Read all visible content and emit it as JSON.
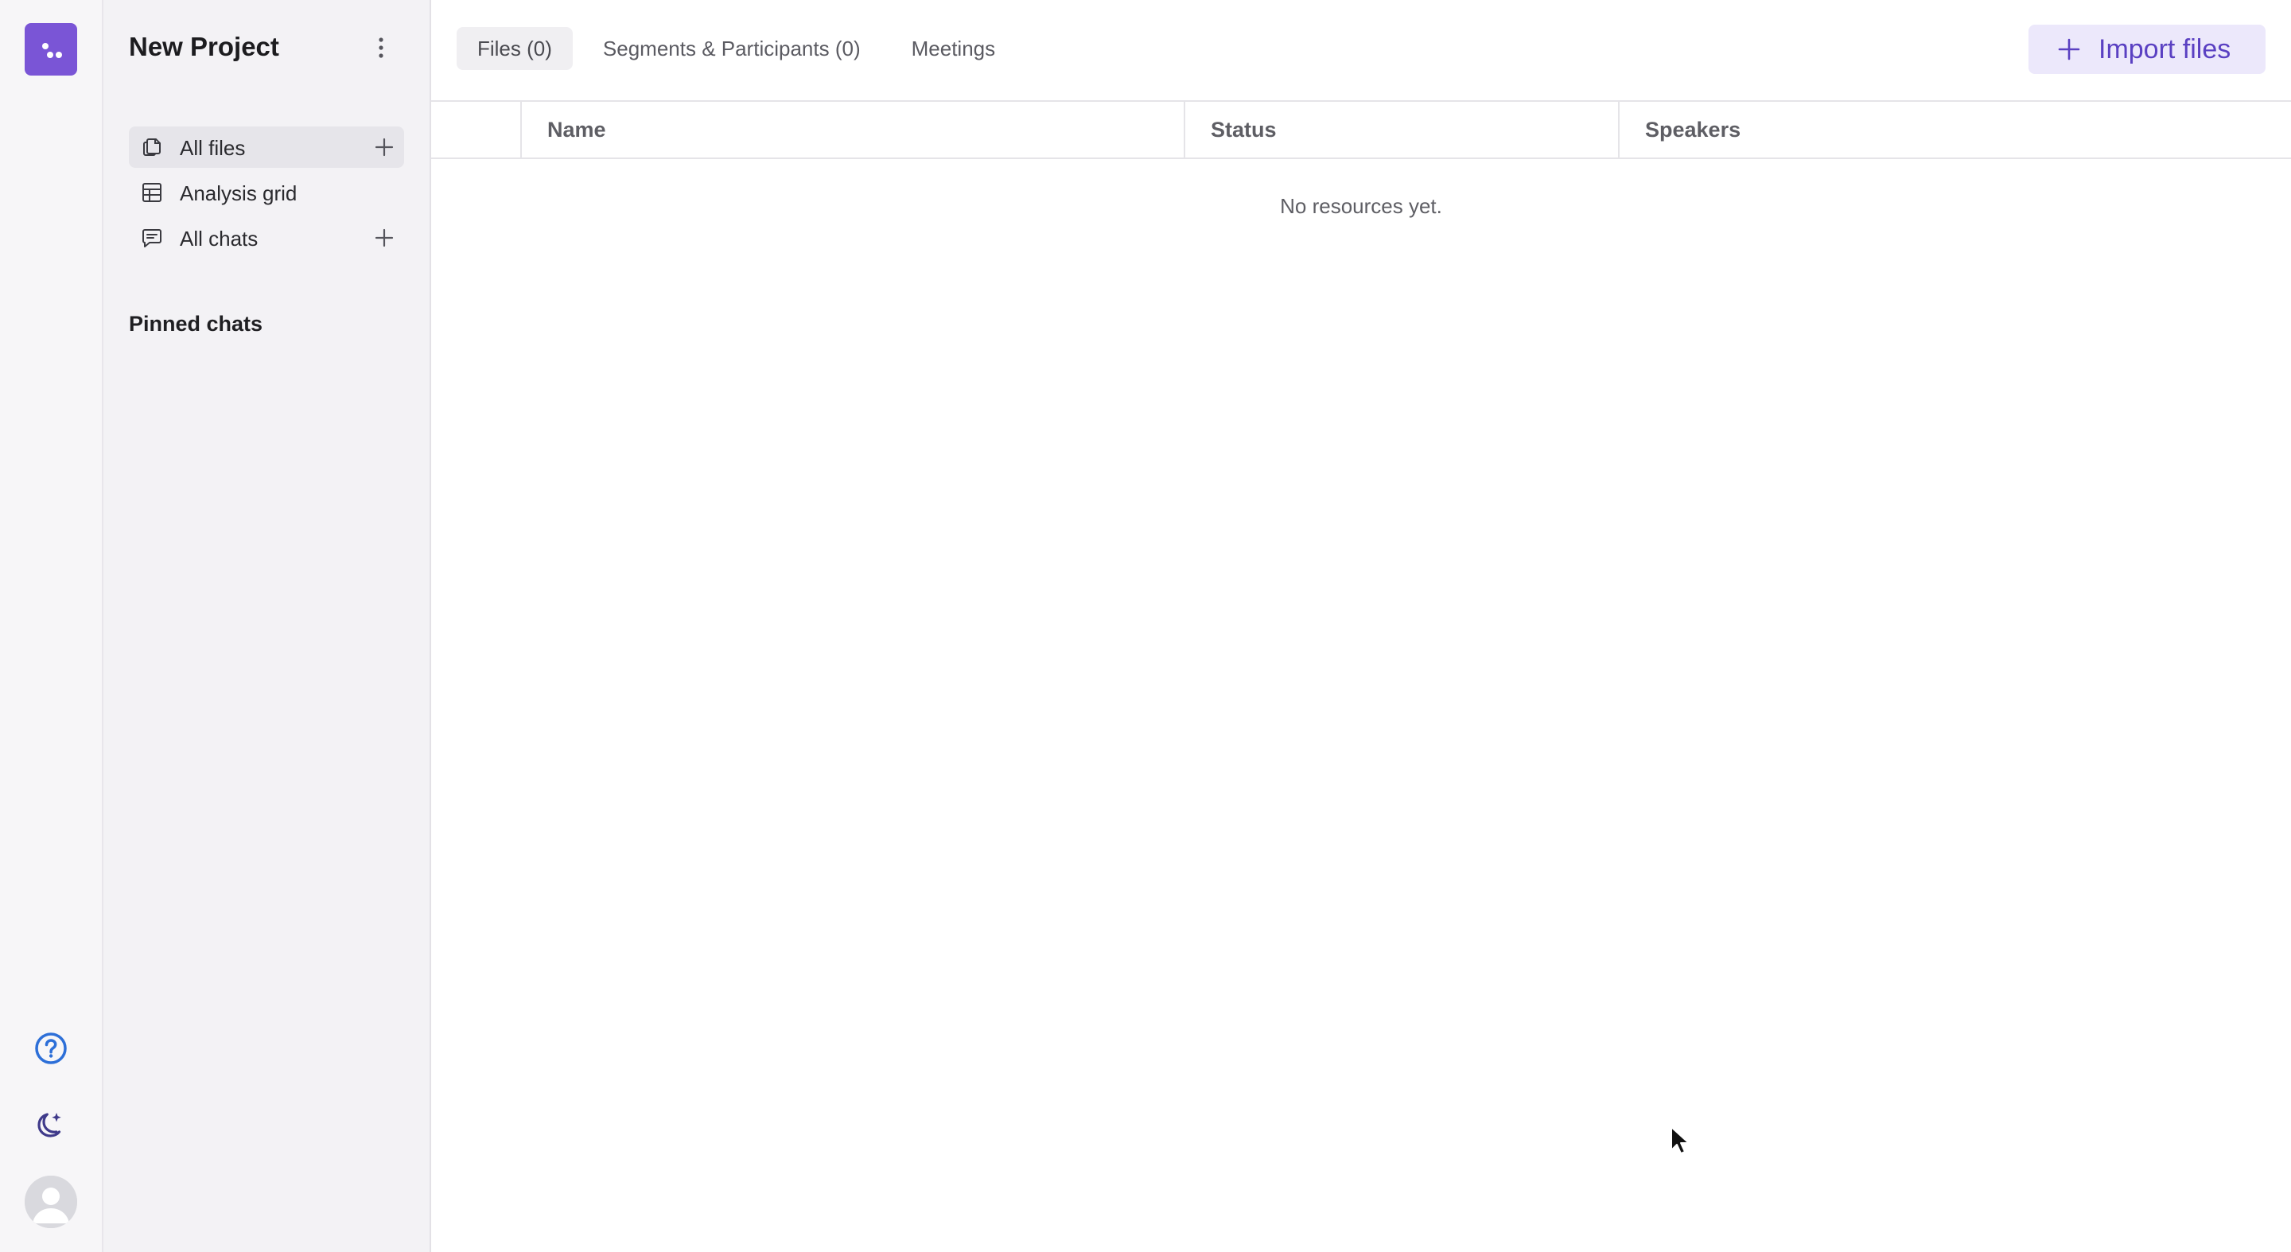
{
  "colors": {
    "accent": "#7a55d6",
    "accent_soft": "#ece8fb",
    "accent_text": "#5a40c2",
    "rail_bg": "#f7f6f8",
    "sidebar_bg": "#f3f2f5",
    "border": "#e5e4e8"
  },
  "rail": {
    "logo_icon": "dots-logo-icon",
    "help_icon": "help-circle-icon",
    "theme_icon": "moon-sparkle-icon",
    "avatar_icon": "user-avatar-icon"
  },
  "sidebar": {
    "project_title": "New Project",
    "menu_icon": "more-vertical-icon",
    "items": [
      {
        "label": "All files",
        "icon": "files-icon",
        "has_add": true,
        "active": true
      },
      {
        "label": "Analysis grid",
        "icon": "grid-icon",
        "has_add": false,
        "active": false
      },
      {
        "label": "All chats",
        "icon": "chat-icon",
        "has_add": true,
        "active": false
      }
    ],
    "pinned_heading": "Pinned chats"
  },
  "main": {
    "tabs": [
      {
        "label": "Files (0)",
        "active": true
      },
      {
        "label": "Segments & Participants (0)",
        "active": false
      },
      {
        "label": "Meetings",
        "active": false
      }
    ],
    "import_button": {
      "label": "Import files",
      "icon": "plus-icon"
    },
    "table": {
      "columns": [
        "Name",
        "Status",
        "Speakers"
      ]
    },
    "empty_message": "No resources yet."
  }
}
